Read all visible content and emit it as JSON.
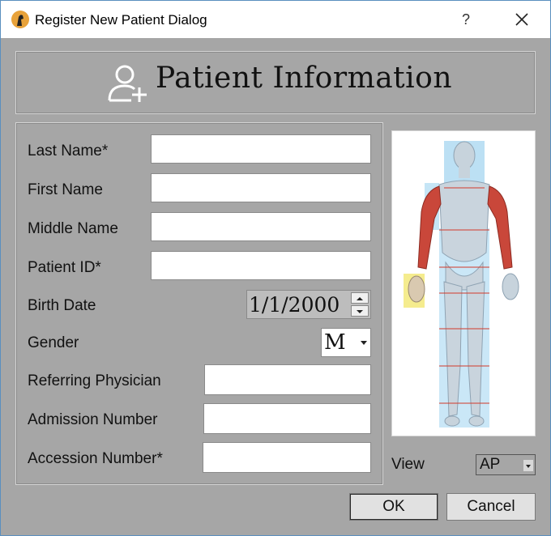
{
  "window": {
    "title": "Register New Patient Dialog",
    "help_label": "?",
    "close_icon": "close-icon",
    "app_icon": "app-logo-icon"
  },
  "header": {
    "title": "Patient Information",
    "icon": "add-user-icon"
  },
  "form": {
    "last_name": {
      "label": "Last Name*",
      "value": ""
    },
    "first_name": {
      "label": "First Name",
      "value": ""
    },
    "middle_name": {
      "label": "Middle Name",
      "value": ""
    },
    "patient_id": {
      "label": "Patient ID*",
      "value": ""
    },
    "birth_date": {
      "label": "Birth Date",
      "value": "1/1/2000"
    },
    "gender": {
      "label": "Gender",
      "value": "M"
    },
    "referring_physician": {
      "label": "Referring Physician",
      "value": ""
    },
    "admission_number": {
      "label": "Admission Number",
      "value": ""
    },
    "accession_number": {
      "label": "Accession Number*",
      "value": ""
    }
  },
  "view": {
    "label": "View",
    "value": "AP"
  },
  "buttons": {
    "ok": "OK",
    "cancel": "Cancel"
  },
  "colors": {
    "dialog_bg": "#a6a6a6",
    "highlight_blue": "#9fd3f0",
    "highlight_yellow": "#f3e97a",
    "muscle_red": "#c9473a"
  }
}
